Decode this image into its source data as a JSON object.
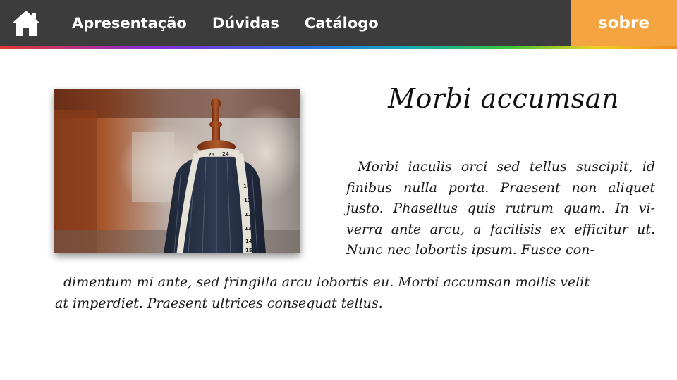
{
  "nav": {
    "home_icon": "home-icon",
    "items": [
      {
        "label": "Apresentação"
      },
      {
        "label": "Dúvidas"
      },
      {
        "label": "Catálogo"
      }
    ],
    "sobre_label": "sobre",
    "bar_color": "#3c3c3c",
    "accent_color": "#f4a541"
  },
  "content": {
    "title": "Morbi accumsan",
    "paragraph_lines": [
      "Morbi iaculis orci sed tellus suscipit, id",
      "finibus nulla porta. Praesent non aliquet",
      "justo. Phasellus quis rutrum quam. In vi-",
      "verra ante arcu, a facilisis ex efficitur ut.",
      "Nunc nec lobortis ipsum. Fusce con-",
      "dimentum mi ante, sed fringilla arcu lobortis eu. Morbi accumsan mollis velit",
      "at imperdiet. Praesent ultrices consequat tellus."
    ],
    "image": {
      "subject": "tailor mannequin with measuring tape",
      "tape_numbers": [
        "23",
        "24",
        "10",
        "11",
        "12",
        "13",
        "14",
        "15"
      ]
    }
  }
}
